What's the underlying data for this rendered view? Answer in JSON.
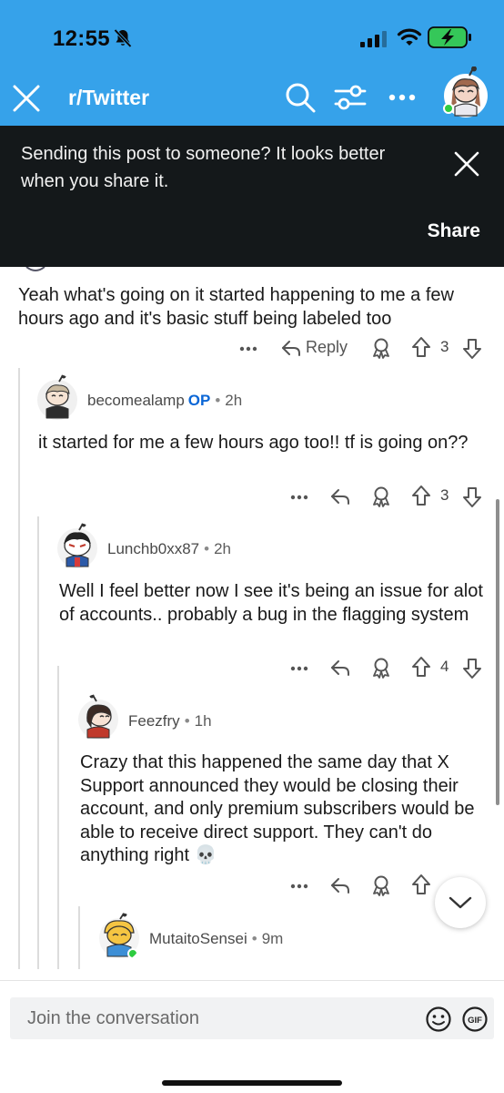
{
  "status_bar": {
    "time": "12:55"
  },
  "header": {
    "subreddit": "r/Twitter"
  },
  "toast": {
    "message": "Sending this post to someone? It looks better when you share it.",
    "share_label": "Share"
  },
  "comments": [
    {
      "text": "Yeah what's going on it started happening to me a few hours ago and it's basic stuff being labeled too",
      "reply_label": "Reply",
      "votes": "3"
    },
    {
      "user": "becomealamp",
      "op_badge": "OP",
      "age": "2h",
      "text": "it started for me a few hours ago too!! tf is going on??",
      "votes": "3"
    },
    {
      "user": "Lunchb0xx87",
      "age": "2h",
      "text": "Well I feel better now I see it's being an issue for alot of accounts.. probably a bug in the flagging system",
      "votes": "4"
    },
    {
      "user": "Feezfry",
      "age": "1h",
      "text": "Crazy that this happened the same day that X Support announced they would be closing their account, and only premium subscribers would be able to receive direct support. They can't do anything right 💀",
      "votes": ""
    },
    {
      "user": "MutaitoSensei",
      "age": "9m"
    }
  ],
  "composer": {
    "placeholder": "Join the conversation",
    "gif_label": "GIF"
  },
  "colors": {
    "header_bg": "#36a2ea",
    "toast_bg": "#14181a",
    "op": "#0a66d6"
  }
}
